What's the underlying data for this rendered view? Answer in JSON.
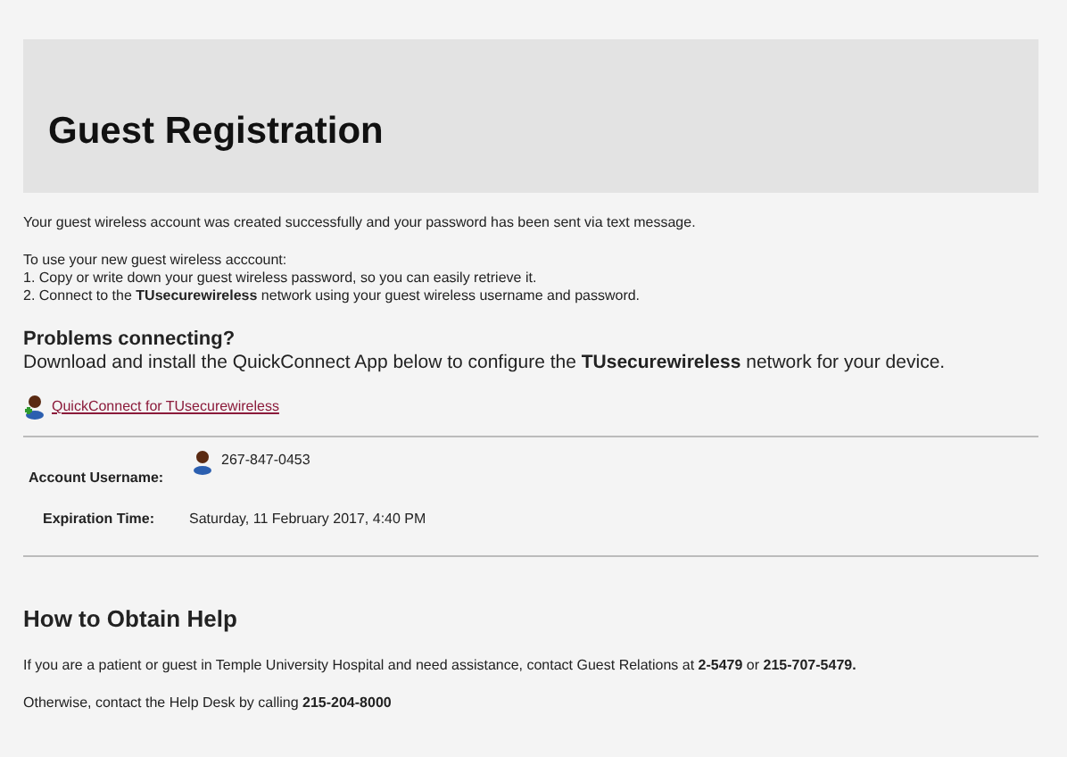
{
  "header": {
    "title": "Guest Registration"
  },
  "confirmation": "Your guest wireless account was created successfully and your password has been sent via text message.",
  "instructions": {
    "intro": "To use your new guest wireless acccount:",
    "steps": [
      "1. Copy or write down your guest wireless password, so you can easily retrieve it.",
      "2. Connect to the **TUsecurewireless** network using your guest wireless username and password."
    ]
  },
  "problems": {
    "heading": "Problems connecting?",
    "text": "Download and install the QuickConnect App below to configure the **TUsecurewireless** network for your device.",
    "link": "QuickConnect for TUsecurewireless"
  },
  "account": {
    "username_label": "Account Username:",
    "username": "267-847-0453",
    "expiration_label": "Expiration Time:",
    "expiration": "Saturday, 11 February 2017, 4:40 PM"
  },
  "help": {
    "heading": "How to Obtain Help",
    "paragraphs": [
      "If you are a patient or guest in Temple University Hospital and need assistance, contact Guest Relations at **2-5479** or **215-707-5479.**",
      "Otherwise, contact the Help Desk by calling **215-204-8000**"
    ]
  }
}
